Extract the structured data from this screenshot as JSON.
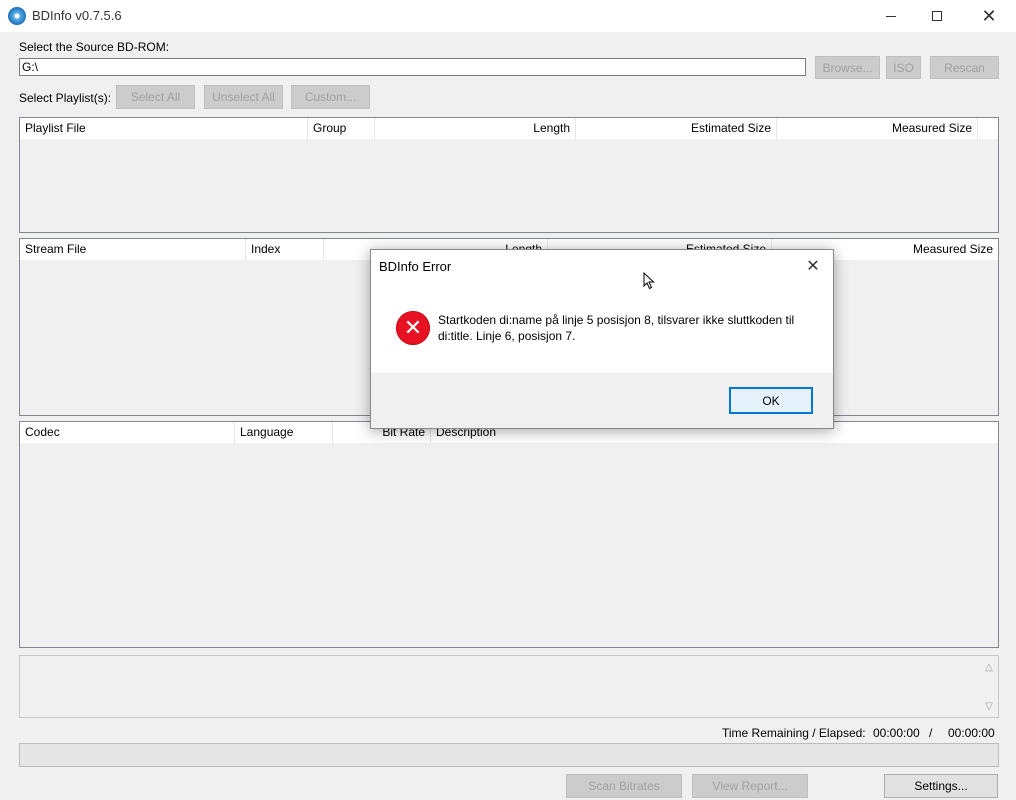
{
  "window": {
    "title": "BDInfo v0.7.5.6"
  },
  "source": {
    "label": "Select the Source BD-ROM:",
    "path_value": "G:\\",
    "browse_label": "Browse...",
    "iso_label": "ISO",
    "rescan_label": "Rescan"
  },
  "playlist_select": {
    "label": "Select Playlist(s):",
    "select_all_label": "Select All",
    "unselect_all_label": "Unselect All",
    "custom_label": "Custom..."
  },
  "playlist_table": {
    "columns": [
      "Playlist File",
      "Group",
      "Length",
      "Estimated Size",
      "Measured Size"
    ]
  },
  "stream_table": {
    "columns": [
      "Stream File",
      "Index",
      "Length",
      "Estimated Size",
      "Measured Size"
    ]
  },
  "codec_table": {
    "columns": [
      "Codec",
      "Language",
      "Bit Rate",
      "Description"
    ]
  },
  "status": {
    "time_label": "Time Remaining / Elapsed:",
    "remaining": "00:00:00",
    "separator": "/",
    "elapsed": "00:00:00"
  },
  "actions": {
    "scan_label": "Scan Bitrates",
    "view_report_label": "View Report...",
    "settings_label": "Settings..."
  },
  "dialog": {
    "title": "BDInfo Error",
    "message": "Startkoden di:name på linje 5 posisjon 8, tilsvarer ikke sluttkoden til di:title. Linje 6, posisjon 7.",
    "ok_label": "OK"
  },
  "icons": {
    "app": "bluray-disc-icon",
    "error": "error-x-icon",
    "cursor": "mouse-pointer-icon"
  },
  "colors": {
    "error_red": "#e81123",
    "focus_blue": "#0078d7"
  }
}
